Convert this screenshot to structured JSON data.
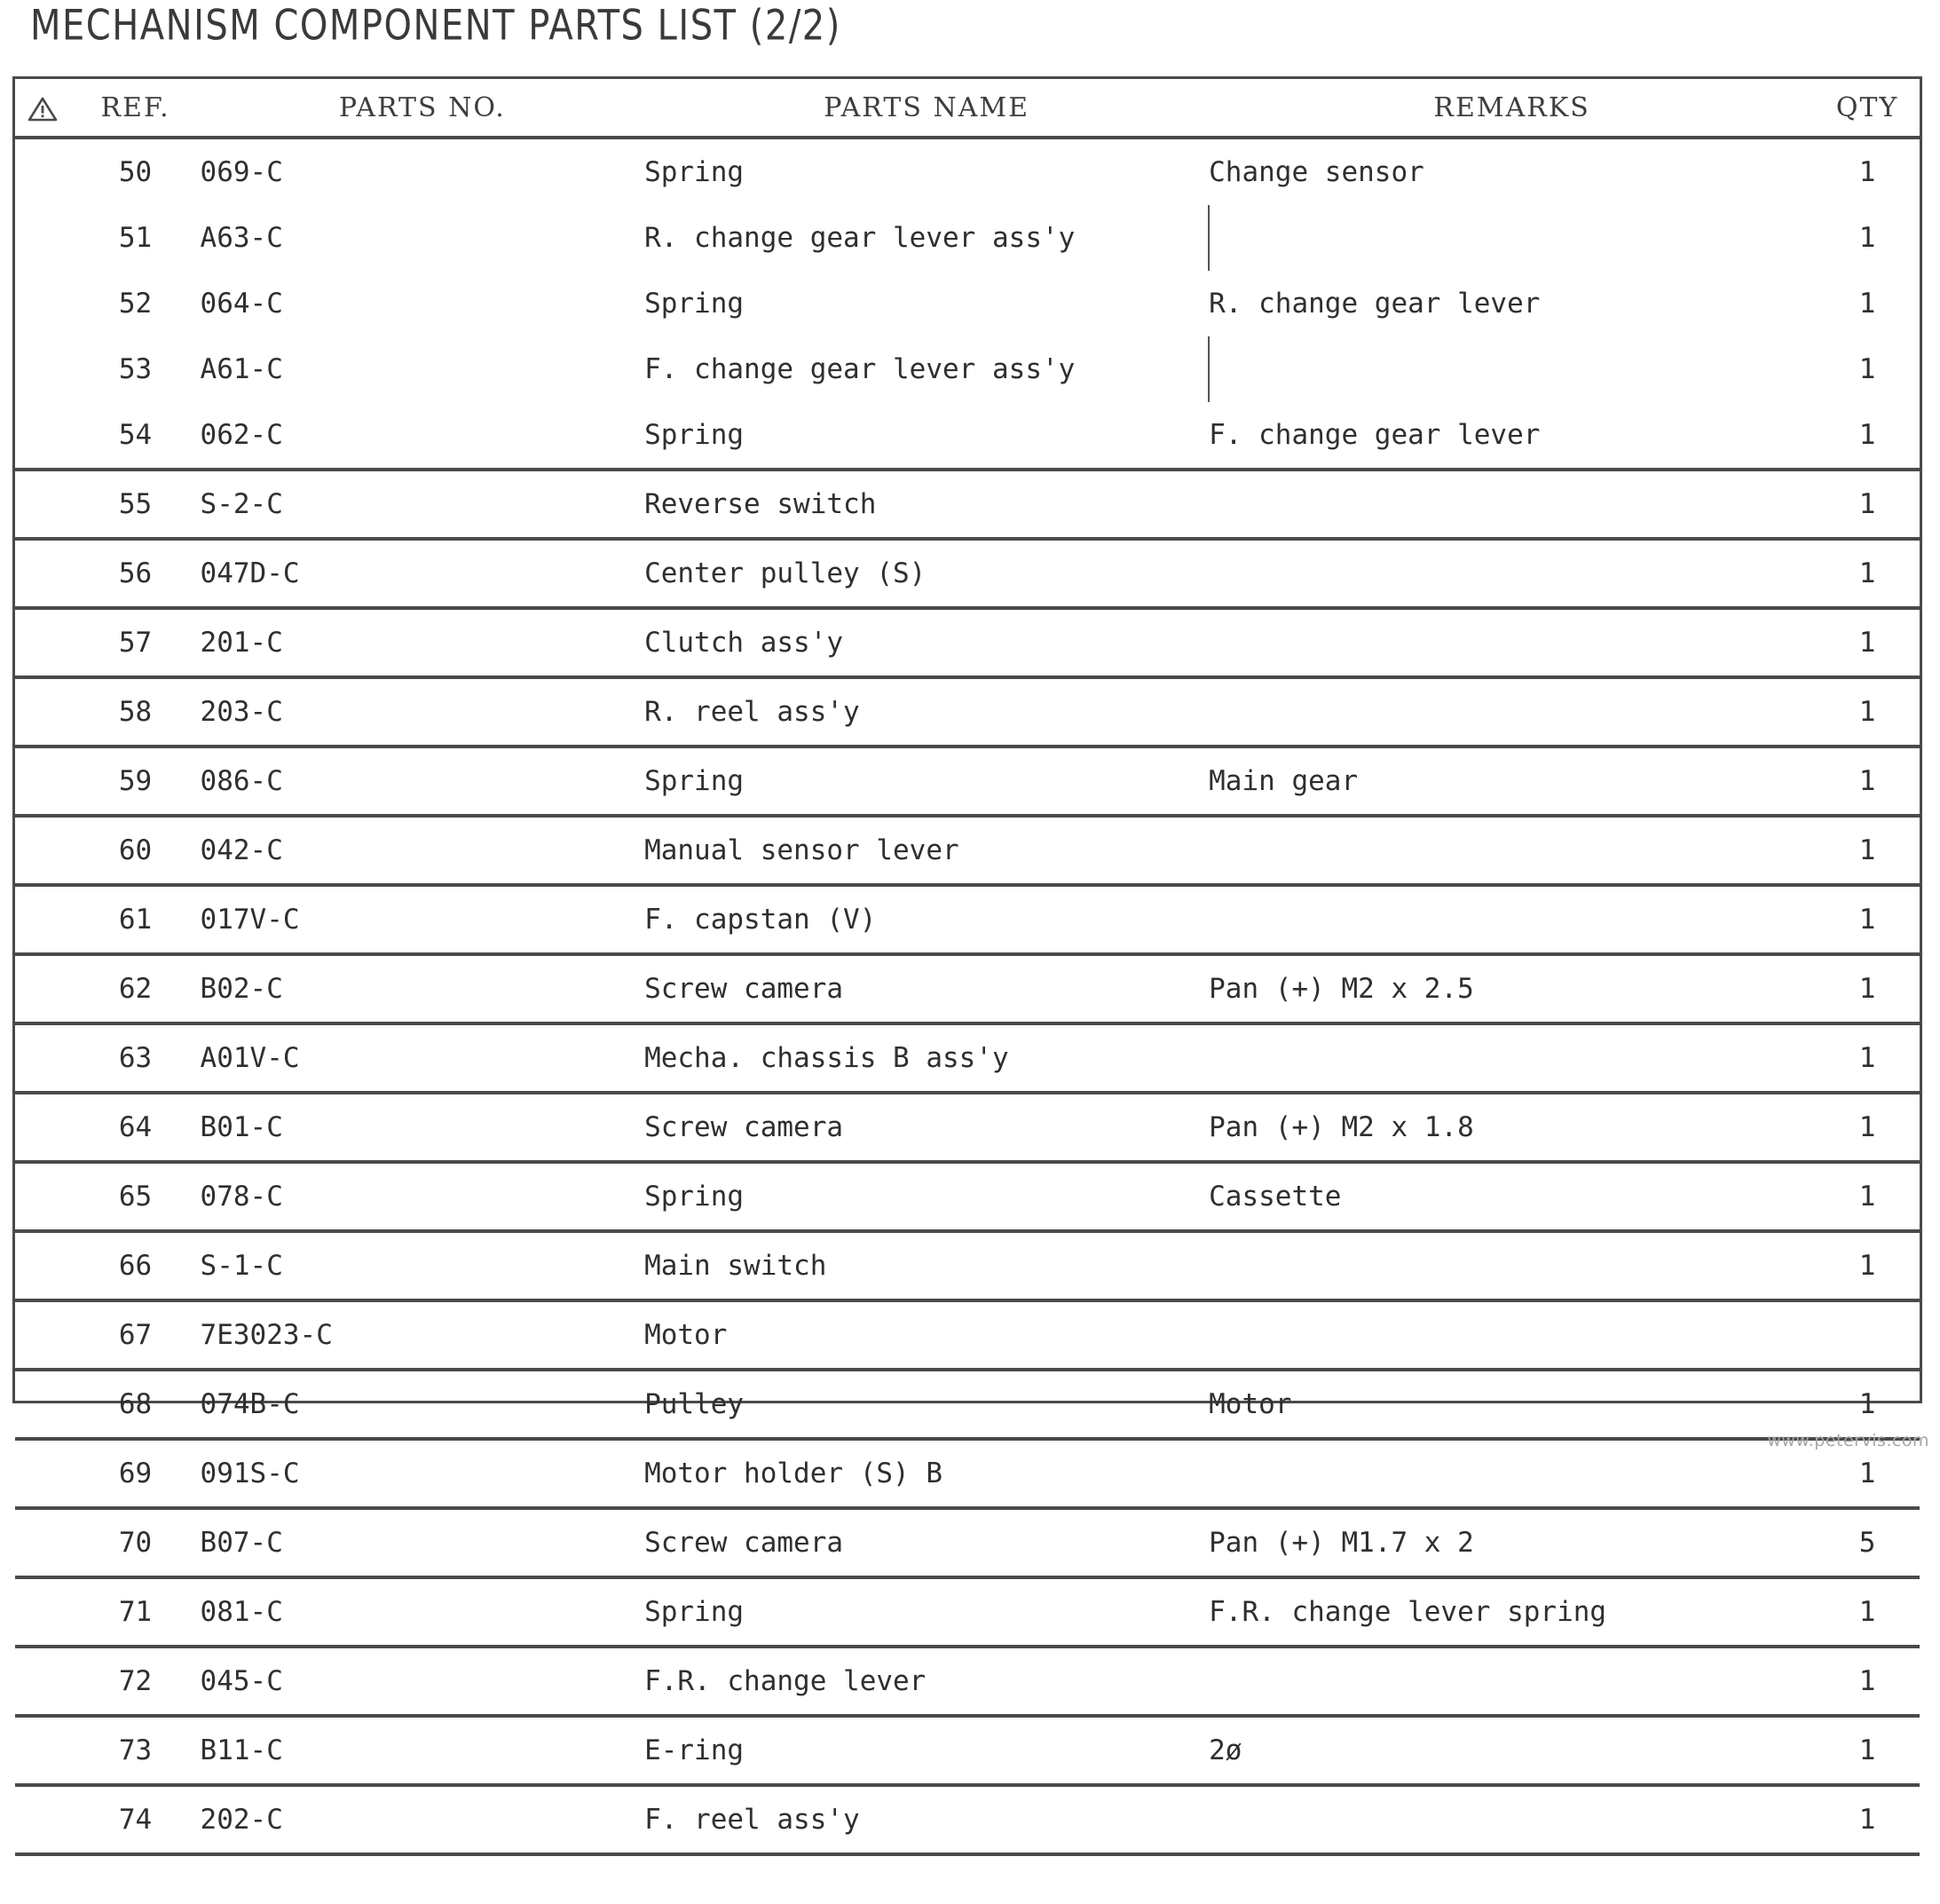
{
  "document": {
    "title": "MECHANISM COMPONENT PARTS LIST (2/2)",
    "watermark": "www.petervis.com"
  },
  "table": {
    "headers": {
      "warning_icon": "warning-triangle-icon",
      "ref": "REF.",
      "parts_no": "PARTS NO.",
      "parts_name": "PARTS NAME",
      "remarks": "REMARKS",
      "qty": "QTY"
    },
    "groups": [
      {
        "rows": [
          {
            "ref": "50",
            "parts_no": "069-C",
            "parts_name": "Spring",
            "remarks": "Change sensor",
            "qty": "1"
          },
          {
            "ref": "51",
            "parts_no": "A63-C",
            "parts_name": "R. change gear lever ass'y",
            "remarks": "",
            "qty": "1"
          },
          {
            "ref": "52",
            "parts_no": "064-C",
            "parts_name": "Spring",
            "remarks": "R. change gear lever",
            "qty": "1"
          },
          {
            "ref": "53",
            "parts_no": "A61-C",
            "parts_name": "F. change gear lever ass'y",
            "remarks": "",
            "qty": "1"
          },
          {
            "ref": "54",
            "parts_no": "062-C",
            "parts_name": "Spring",
            "remarks": "F. change gear lever",
            "qty": "1"
          }
        ]
      },
      {
        "rows": [
          {
            "ref": "55",
            "parts_no": "S-2-C",
            "parts_name": "Reverse switch",
            "remarks": "",
            "qty": "1"
          },
          {
            "ref": "56",
            "parts_no": "047D-C",
            "parts_name": "Center pulley (S)",
            "remarks": "",
            "qty": "1"
          },
          {
            "ref": "57",
            "parts_no": "201-C",
            "parts_name": "Clutch ass'y",
            "remarks": "",
            "qty": "1"
          },
          {
            "ref": "58",
            "parts_no": "203-C",
            "parts_name": "R. reel ass'y",
            "remarks": "",
            "qty": "1"
          },
          {
            "ref": "59",
            "parts_no": "086-C",
            "parts_name": "Spring",
            "remarks": "Main gear",
            "qty": "1"
          }
        ]
      },
      {
        "rows": [
          {
            "ref": "60",
            "parts_no": "042-C",
            "parts_name": "Manual sensor lever",
            "remarks": "",
            "qty": "1"
          },
          {
            "ref": "61",
            "parts_no": "017V-C",
            "parts_name": "F. capstan (V)",
            "remarks": "",
            "qty": "1"
          },
          {
            "ref": "62",
            "parts_no": "B02-C",
            "parts_name": "Screw camera",
            "remarks": "Pan (+) M2 x 2.5",
            "qty": "1"
          },
          {
            "ref": "63",
            "parts_no": "A01V-C",
            "parts_name": "Mecha. chassis B ass'y",
            "remarks": "",
            "qty": "1"
          },
          {
            "ref": "64",
            "parts_no": "B01-C",
            "parts_name": "Screw camera",
            "remarks": "Pan (+) M2 x 1.8",
            "qty": "1"
          }
        ]
      },
      {
        "rows": [
          {
            "ref": "65",
            "parts_no": "078-C",
            "parts_name": "Spring",
            "remarks": "Cassette",
            "qty": "1"
          },
          {
            "ref": "66",
            "parts_no": "S-1-C",
            "parts_name": "Main switch",
            "remarks": "",
            "qty": "1"
          },
          {
            "ref": "67",
            "parts_no": "7E3023-C",
            "parts_name": "Motor",
            "remarks": "",
            "qty": ""
          },
          {
            "ref": "68",
            "parts_no": "074B-C",
            "parts_name": "Pulley",
            "remarks": "Motor",
            "qty": "1"
          },
          {
            "ref": "69",
            "parts_no": "091S-C",
            "parts_name": "Motor holder (S) B",
            "remarks": "",
            "qty": "1"
          }
        ]
      },
      {
        "rows": [
          {
            "ref": "70",
            "parts_no": "B07-C",
            "parts_name": "Screw camera",
            "remarks": "Pan (+) M1.7 x 2",
            "qty": "5"
          },
          {
            "ref": "71",
            "parts_no": "081-C",
            "parts_name": "Spring",
            "remarks": "F.R. change lever spring",
            "qty": "1"
          },
          {
            "ref": "72",
            "parts_no": "045-C",
            "parts_name": "F.R. change lever",
            "remarks": "",
            "qty": "1"
          },
          {
            "ref": "73",
            "parts_no": "B11-C",
            "parts_name": "E-ring",
            "remarks": "2ø",
            "qty": "1"
          },
          {
            "ref": "74",
            "parts_no": "202-C",
            "parts_name": "F. reel ass'y",
            "remarks": "",
            "qty": "1"
          }
        ]
      }
    ]
  }
}
